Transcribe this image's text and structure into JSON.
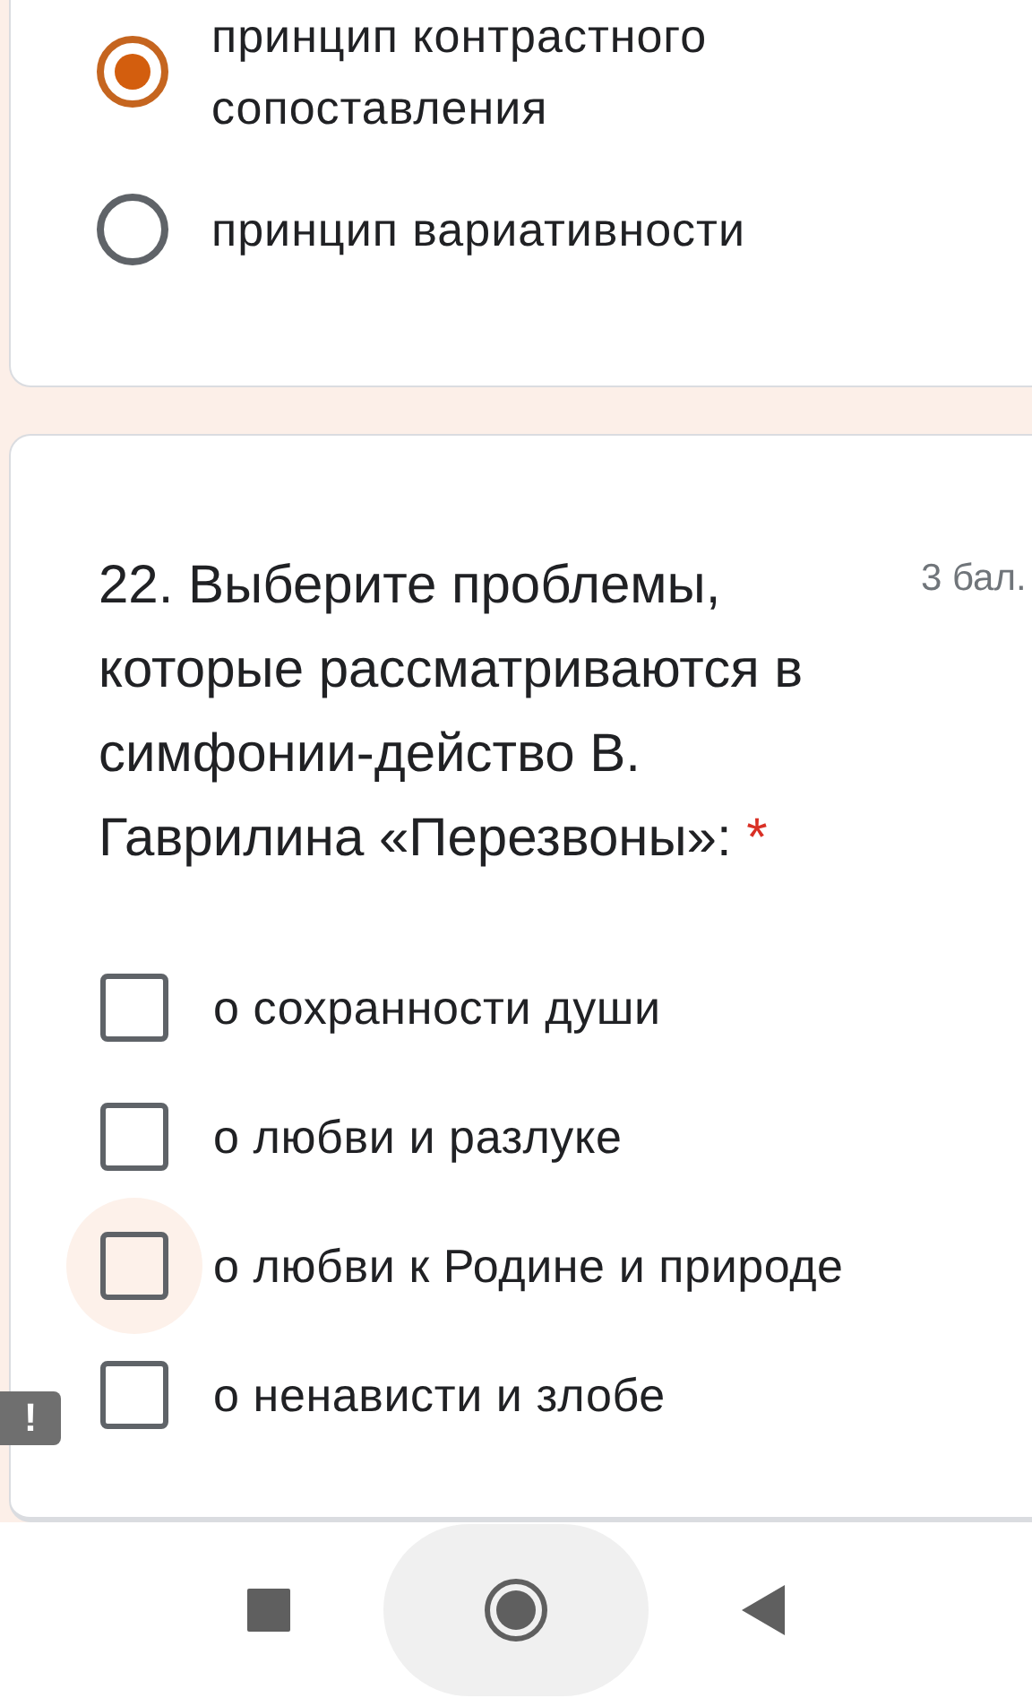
{
  "previous_question": {
    "options": [
      {
        "label": "принцип контрастного сопоставления",
        "selected": true
      },
      {
        "label": "принцип вариативности",
        "selected": false
      }
    ]
  },
  "question": {
    "title": "22. Выберите проблемы, которые рассматриваются в симфонии-действо В. Гаврилина «Перезвоны»:",
    "required_mark": "*",
    "points": "3 бал.",
    "options": [
      {
        "label": "о сохранности души",
        "checked": false,
        "focused": false
      },
      {
        "label": "о любви и разлуке",
        "checked": false,
        "focused": false
      },
      {
        "label": "о любви к Родине и природе",
        "checked": false,
        "focused": true
      },
      {
        "label": "о ненависти и злобе",
        "checked": false,
        "focused": false
      }
    ]
  },
  "feedback_tab": {
    "label": "!"
  }
}
